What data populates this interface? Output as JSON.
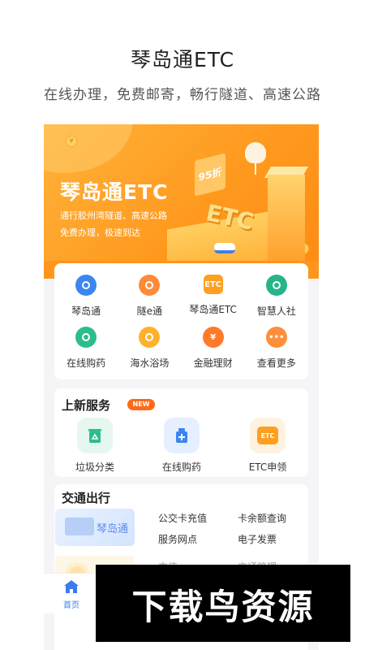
{
  "promo": {
    "title": "琴岛通ETC",
    "subtitle": "在线办理，免费邮寄，畅行隧道、高速公路"
  },
  "banner": {
    "title": "琴岛通ETC",
    "line1": "通行胶州湾隧道、高速公路",
    "line2": "免费办理，极速到达",
    "discount_sign": "95折",
    "etc_3d": "ETC",
    "coin": "¥"
  },
  "quick_grid": {
    "items": [
      {
        "label": "琴岛通",
        "icon": "qindaotong-logo-icon",
        "color": "#3b86f0"
      },
      {
        "label": "隧e通",
        "icon": "tunnel-icon",
        "color": "#ff8a3a"
      },
      {
        "label": "琴岛通ETC",
        "icon": "etc-icon",
        "color": "#ff9f1f",
        "icon_text": "ETC"
      },
      {
        "label": "智慧人社",
        "icon": "social-security-icon",
        "color": "#26b58a"
      },
      {
        "label": "在线购药",
        "icon": "medicine-icon",
        "color": "#2bbd8e"
      },
      {
        "label": "海水浴场",
        "icon": "beach-icon",
        "color": "#ffb02b"
      },
      {
        "label": "金融理财",
        "icon": "finance-icon",
        "color": "#ff7a2a",
        "icon_text": "¥"
      },
      {
        "label": "查看更多",
        "icon": "more-icon",
        "color": "#ff8f3a",
        "icon_text": "•••"
      }
    ]
  },
  "new_services": {
    "title": "上新服务",
    "badge": "NEW",
    "items": [
      {
        "label": "垃圾分类",
        "icon": "trash-sort-icon",
        "bg": "#e6f7ef",
        "color": "#2bbd8e"
      },
      {
        "label": "在线购药",
        "icon": "medicine-bottle-icon",
        "bg": "#e6efff",
        "color": "#3b86f0"
      },
      {
        "label": "ETC申领",
        "icon": "etc-apply-icon",
        "bg": "#fff3e0",
        "color": "#ff9f1f",
        "icon_text": "ETC"
      }
    ]
  },
  "traffic": {
    "title": "交通出行",
    "card_name": "琴岛通",
    "links": [
      "公交卡充值",
      "卡余额查询",
      "服务网点",
      "电子发票"
    ],
    "links_faded": [
      "充值",
      "交通管理"
    ]
  },
  "tabbar": {
    "home_label": "首页",
    "home_color": "#3b7cf0"
  },
  "watermark": {
    "text": "下载鸟资源"
  }
}
